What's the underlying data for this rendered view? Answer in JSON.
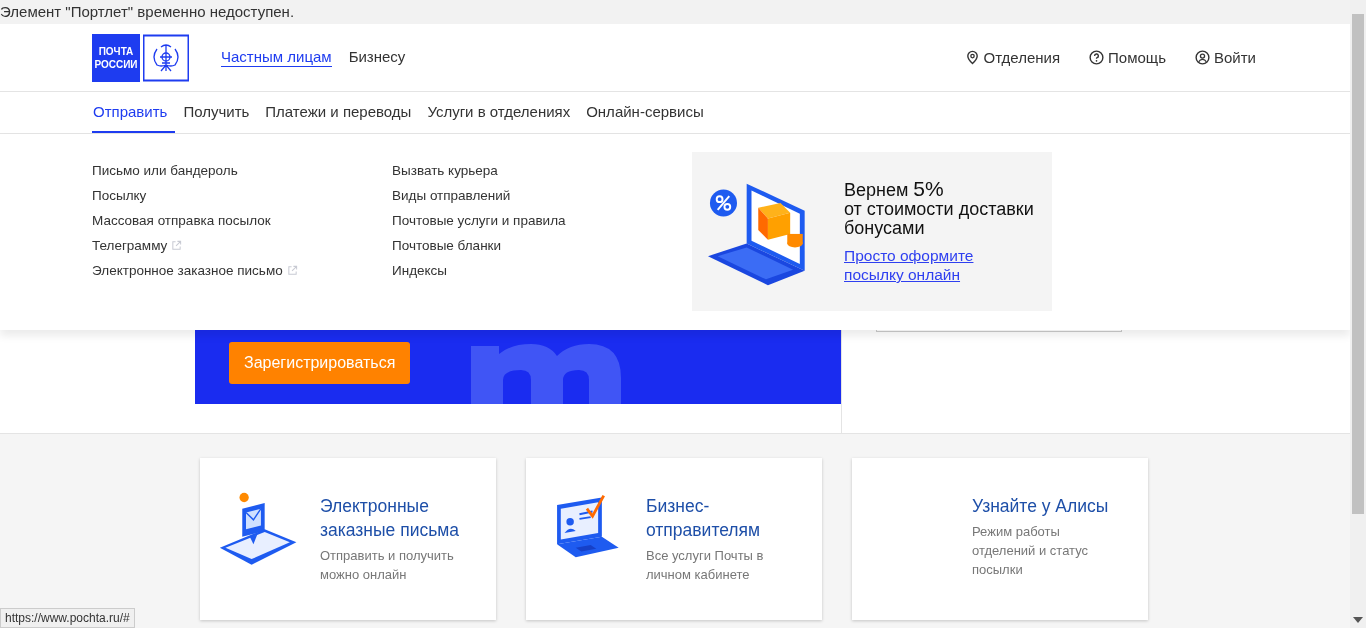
{
  "notice": "Элемент \"Портлет\" временно недоступен.",
  "logo": {
    "line_1": "ПОЧТА",
    "line_2": "РОССИИ"
  },
  "audience_tabs": [
    {
      "label": "Частным лицам",
      "selected": true
    },
    {
      "label": "Бизнесу",
      "selected": false
    }
  ],
  "header_links": [
    {
      "kind": "pin",
      "label": "Отделения"
    },
    {
      "kind": "help",
      "label": "Помощь"
    },
    {
      "kind": "user",
      "label": "Войти"
    }
  ],
  "main_nav": [
    {
      "label": "Отправить",
      "selected": true
    },
    {
      "label": "Получить",
      "selected": false
    },
    {
      "label": "Платежи и переводы",
      "selected": false
    },
    {
      "label": "Услуги в отделениях",
      "selected": false
    },
    {
      "label": "Онлайн-сервисы",
      "selected": false
    }
  ],
  "dropdown": {
    "columns": [
      [
        {
          "label": "Письмо или бандероль",
          "external": false
        },
        {
          "label": "Посылку",
          "external": false
        },
        {
          "label": "Массовая отправка посылок",
          "external": false
        },
        {
          "label": "Телеграмму",
          "external": true
        },
        {
          "label": "Электронное заказное письмо",
          "external": true
        }
      ],
      [
        {
          "label": "Вызвать курьера",
          "external": false
        },
        {
          "label": "Виды отправлений",
          "external": false
        },
        {
          "label": "Почтовые услуги и правила",
          "external": false
        },
        {
          "label": "Почтовые бланки",
          "external": false
        },
        {
          "label": "Индексы",
          "external": false
        }
      ]
    ],
    "promo": {
      "title_prefix": "Вернем",
      "title_value": "5%",
      "title_rest": "от стоимости доставки бонусами",
      "link": "Просто оформите посылку онлайн"
    }
  },
  "hero": {
    "button": "Зарегистрироваться"
  },
  "cards": [
    {
      "kind": "mail",
      "title": "Электронные заказные письма",
      "text": "Отправить и получить можно онлайн"
    },
    {
      "kind": "business",
      "title": "Бизнес-отправителям",
      "text": "Все услуги Почты в личном кабинете"
    },
    {
      "kind": "none",
      "title": "Узнайте у Алисы",
      "text": "Режим работы отделений и статус посылки"
    }
  ],
  "status_bar": "https://www.pochta.ru/#"
}
